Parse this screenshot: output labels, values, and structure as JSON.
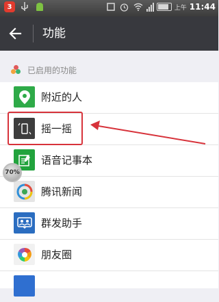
{
  "status_bar": {
    "notification_count": "3",
    "ampm": "上午",
    "time": "11:44"
  },
  "header": {
    "title": "功能"
  },
  "section": {
    "label": "已启用的功能"
  },
  "features": [
    {
      "label": "附近的人",
      "icon": "location-pin-icon",
      "color": "#2eaa48"
    },
    {
      "label": "摇一摇",
      "icon": "shake-phone-icon",
      "color": "#3d3d3d"
    },
    {
      "label": "语音记事本",
      "icon": "voice-notepad-icon",
      "color": "#22a33d"
    },
    {
      "label": "腾讯新闻",
      "icon": "tencent-news-icon",
      "color": "#e5e5e5"
    },
    {
      "label": "群发助手",
      "icon": "group-send-icon",
      "color": "#2b6dc0"
    },
    {
      "label": "朋友圈",
      "icon": "moments-icon",
      "color": "#f1f1f1"
    },
    {
      "label": "",
      "icon": "partial-item-icon",
      "color": "#2f6fd0"
    }
  ],
  "overlay": {
    "badge_text": "70%"
  },
  "colors": {
    "highlight": "#d7323a",
    "titlebar": "#38393e",
    "background": "#efeff4"
  }
}
